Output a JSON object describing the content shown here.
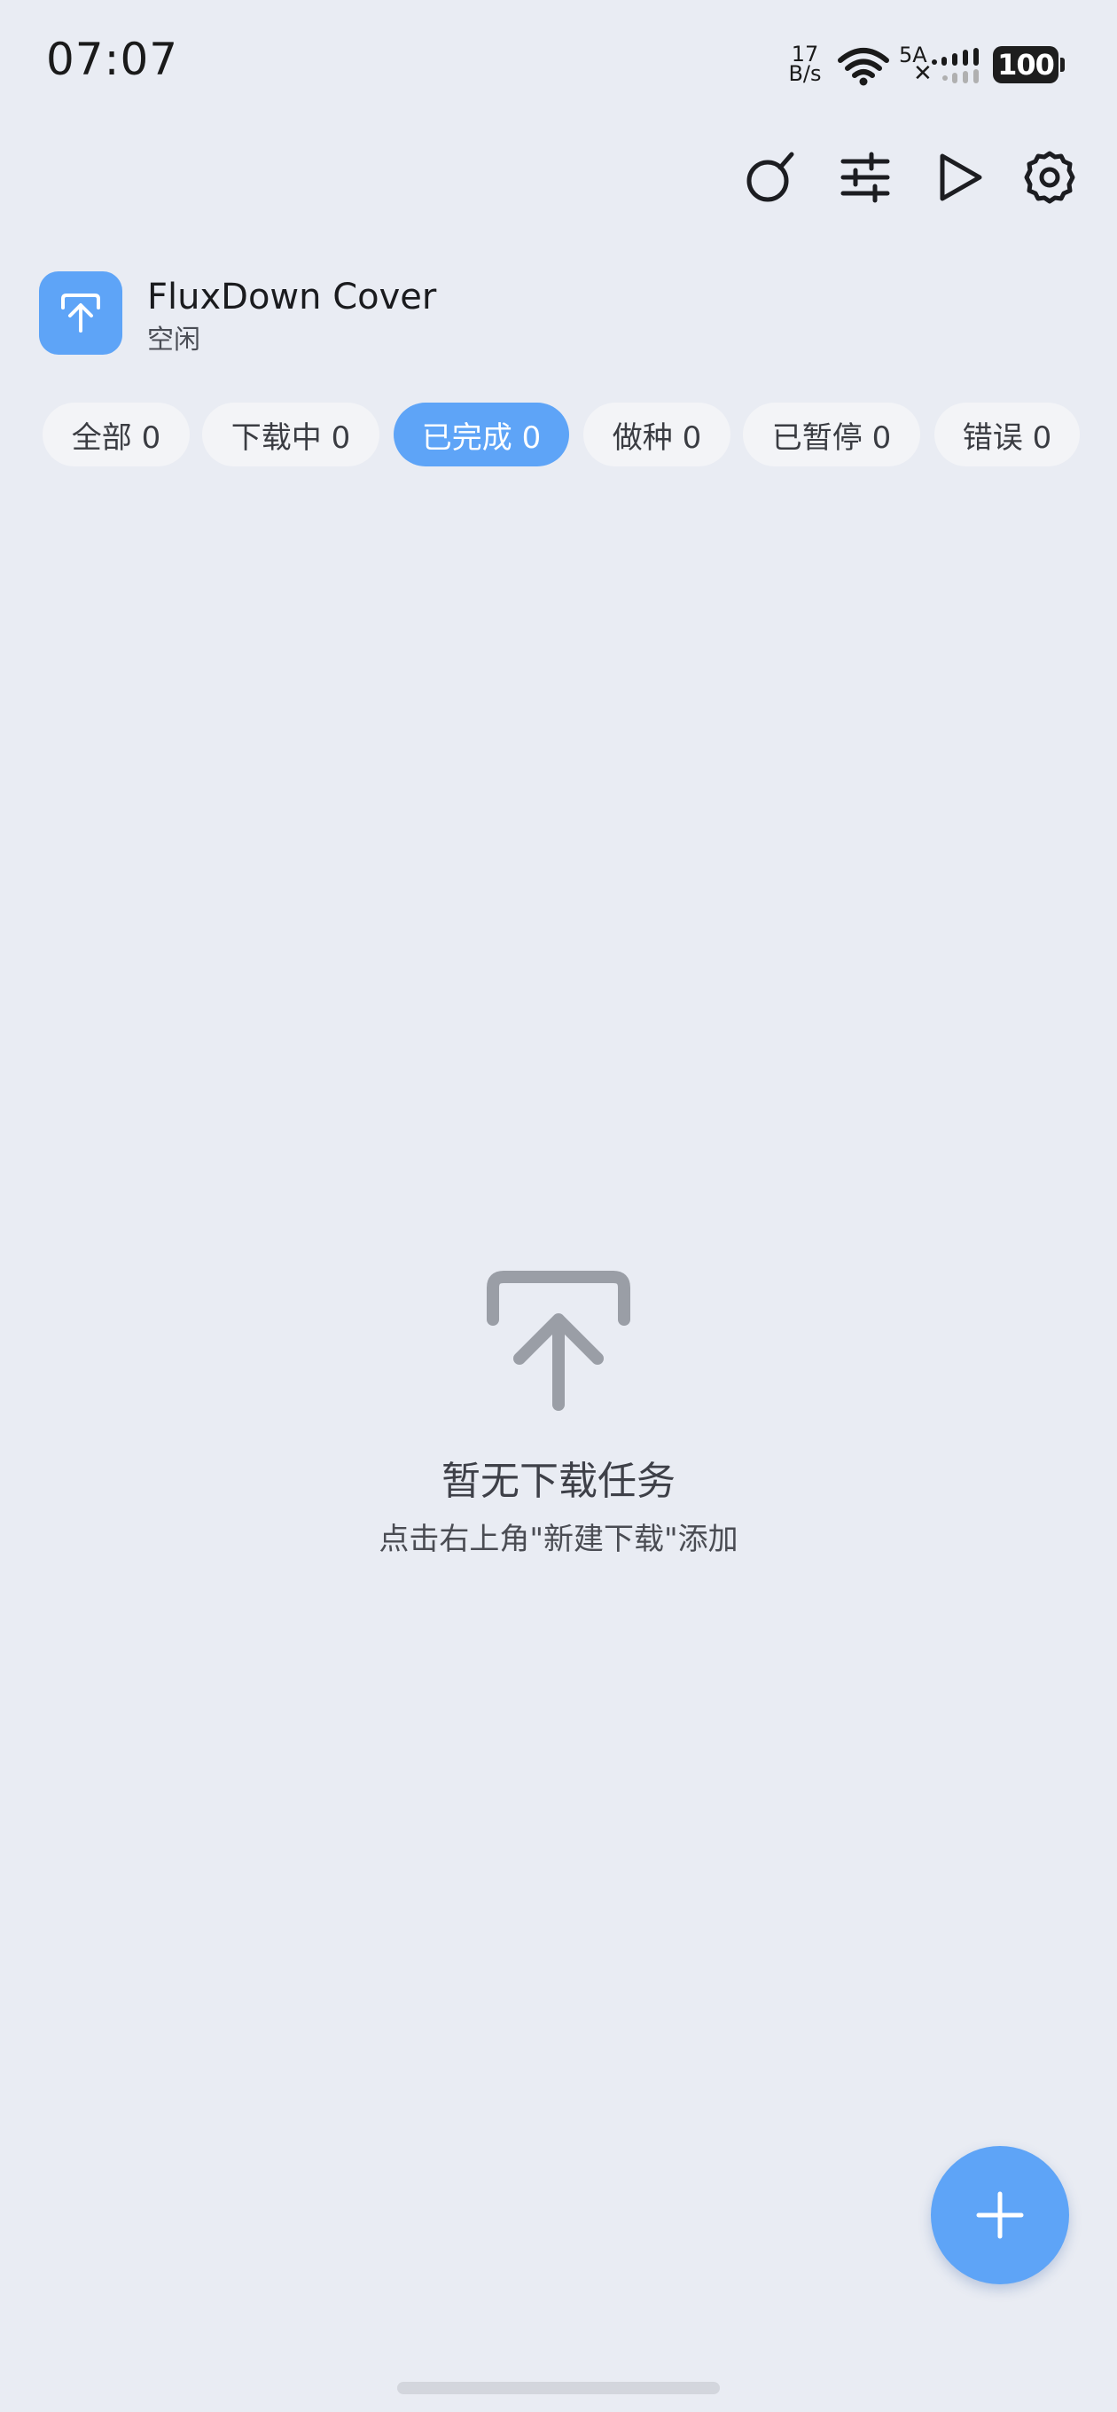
{
  "status_bar": {
    "time": "07:07",
    "net_speed_value": "17",
    "net_speed_unit": "B/s",
    "cellular_label": "5A",
    "cellular_no_signal": "✕",
    "battery": "100"
  },
  "toolbar": {
    "icons": [
      "search-icon",
      "filter-sliders-icon",
      "play-icon",
      "settings-gear-icon"
    ]
  },
  "app": {
    "title": "FluxDown Cover",
    "status": "空闲"
  },
  "filters": [
    {
      "label": "全部 0",
      "active": false
    },
    {
      "label": "下载中 0",
      "active": false
    },
    {
      "label": "已完成 0",
      "active": true
    },
    {
      "label": "做种 0",
      "active": false
    },
    {
      "label": "已暂停 0",
      "active": false
    },
    {
      "label": "错误 0",
      "active": false
    }
  ],
  "empty_state": {
    "title": "暂无下载任务",
    "hint": "点击右上角\"新建下载\"添加"
  },
  "colors": {
    "accent": "#5ea4f7",
    "background": "#e9ecf3",
    "chip_inactive": "#f3f4f7",
    "empty_icon": "#9a9ea6"
  }
}
